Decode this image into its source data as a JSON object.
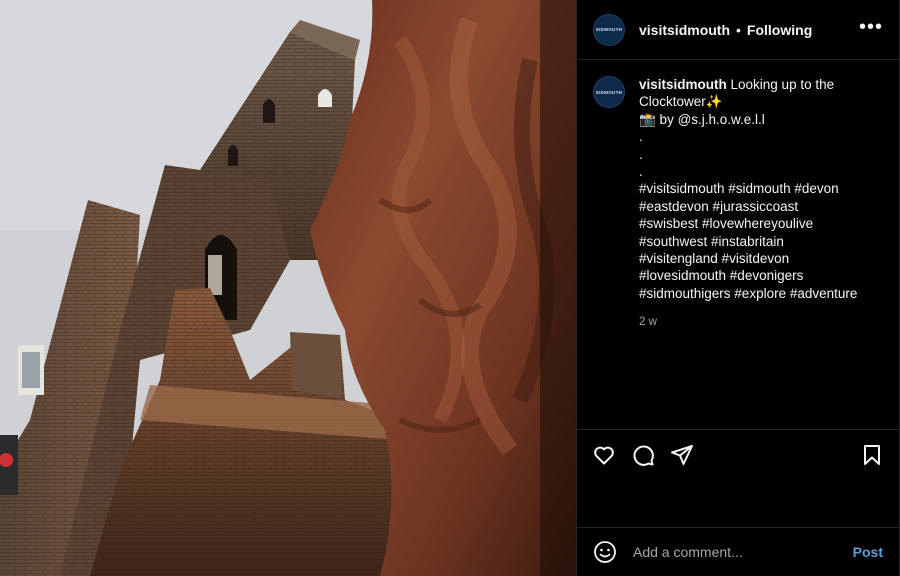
{
  "post": {
    "username": "visitsidmouth",
    "follow_status": "Following",
    "separator": "•",
    "more_glyph": "•••",
    "avatar_text": "SIDMOUTH"
  },
  "caption": {
    "username": "visitsidmouth",
    "text_first": " Looking up to the",
    "lines": [
      "Clocktower✨",
      "📸 by @s.j.h.o.w.e.l.l",
      ".",
      ".",
      ".",
      "#visitsidmouth #sidmouth #devon",
      "#eastdevon #jurassiccoast",
      "#swisbest #lovewhereyoulive",
      "#southwest #instabritain",
      "#visitengland #visitdevon",
      "#lovesidmouth #devonigers",
      "#sidmouthigers #explore #adventure"
    ],
    "time": "2 w"
  },
  "actions": {
    "like_icon": "heart-icon",
    "comment_icon": "comment-icon",
    "share_icon": "share-icon",
    "save_icon": "bookmark-icon"
  },
  "comment_box": {
    "placeholder": "Add a comment...",
    "post_label": "Post",
    "emoji_icon": "emoji-icon"
  },
  "colors": {
    "background": "#000000",
    "border": "#262626",
    "text": "#f5f5f5",
    "muted": "#a8a8a8",
    "post_button": "#5a9fd6",
    "avatar_bg": "#0d2a4a"
  }
}
